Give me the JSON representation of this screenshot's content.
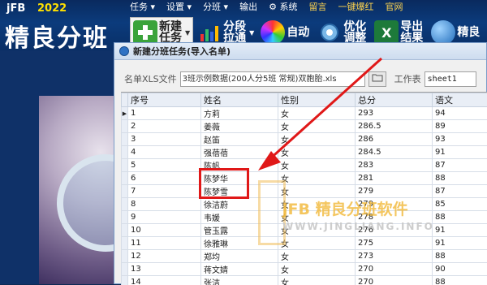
{
  "brand": {
    "small": "jFB",
    "year": "2022",
    "big": "精良分班"
  },
  "menu": [
    "任务",
    "设置",
    "分班",
    "输出",
    "系统",
    "留言",
    "一键爆红",
    "官网"
  ],
  "toolbar": {
    "new_task": "新建任务",
    "grade_div": "分段拉通",
    "auto": "自动",
    "optimize": "优化调整",
    "export": "导出结果",
    "jingbian": "精良"
  },
  "dialog": {
    "title": "新建分班任务(导入名单)",
    "file_label": "名单XLS文件",
    "file_value": "3班示例数据(200人分5班 常规)双胞胎.xls",
    "sheet_label": "工作表",
    "sheet_value": "sheet1"
  },
  "grid": {
    "columns": [
      "序号",
      "姓名",
      "性别",
      "总分",
      "语文"
    ],
    "rows": [
      [
        "1",
        "方莉",
        "女",
        "293",
        "94"
      ],
      [
        "2",
        "姜薇",
        "女",
        "286.5",
        "89"
      ],
      [
        "3",
        "赵笛",
        "女",
        "286",
        "93"
      ],
      [
        "4",
        "强蓓蓓",
        "女",
        "284.5",
        "91"
      ],
      [
        "5",
        "陈帆",
        "女",
        "283",
        "87"
      ],
      [
        "6",
        "陈梦华",
        "女",
        "281",
        "88"
      ],
      [
        "7",
        "陈梦雪",
        "女",
        "279",
        "87"
      ],
      [
        "8",
        "徐洁蔚",
        "女",
        "279",
        "85"
      ],
      [
        "9",
        "韦媛",
        "女",
        "278",
        "88"
      ],
      [
        "10",
        "管玉露",
        "女",
        "276",
        "91"
      ],
      [
        "11",
        "徐雅琳",
        "女",
        "275",
        "91"
      ],
      [
        "12",
        "郑均",
        "女",
        "273",
        "88"
      ],
      [
        "13",
        "蒋文婧",
        "女",
        "270",
        "90"
      ],
      [
        "14",
        "张洁",
        "女",
        "270",
        "88"
      ]
    ]
  },
  "watermark": {
    "title": "jFB 精良分班软件",
    "url": "WWW.JINGLIANG.INFO"
  },
  "colors": {
    "highlight": "#e01818",
    "accent": "#2f72c4"
  }
}
